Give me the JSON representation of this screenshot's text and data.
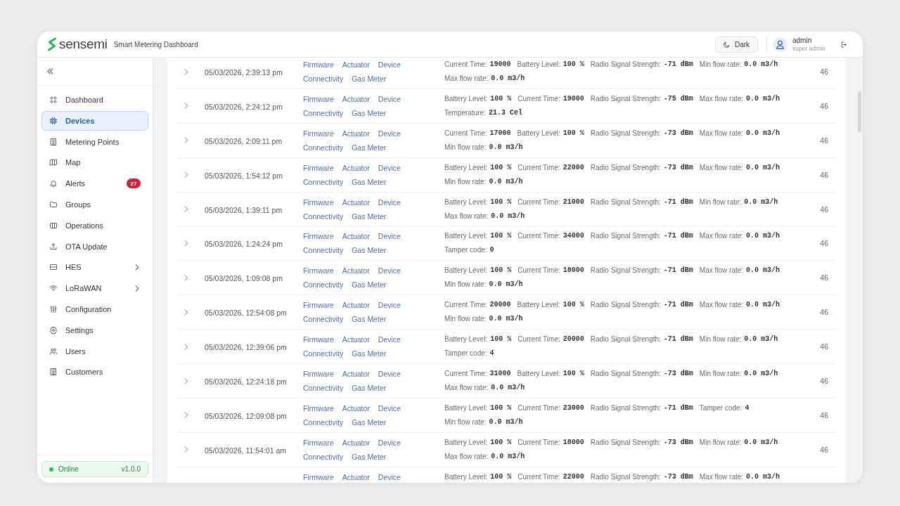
{
  "header": {
    "brand": "sensemi",
    "subtitle": "Smart Metering Dashboard",
    "theme_button": "Dark",
    "user": {
      "name": "admin",
      "role": "super admin"
    }
  },
  "sidebar": {
    "items": [
      {
        "label": "Dashboard",
        "kind": "link",
        "selected": false
      },
      {
        "label": "Devices",
        "kind": "link",
        "selected": true
      },
      {
        "label": "Metering Points",
        "kind": "link",
        "selected": false
      },
      {
        "label": "Map",
        "kind": "link",
        "selected": false
      },
      {
        "label": "Alerts",
        "kind": "link",
        "selected": false,
        "badge": "27"
      },
      {
        "label": "Groups",
        "kind": "link",
        "selected": false
      },
      {
        "label": "Operations",
        "kind": "link",
        "selected": false
      },
      {
        "label": "OTA Update",
        "kind": "link",
        "selected": false
      },
      {
        "label": "HES",
        "kind": "submenu",
        "selected": false,
        "expanded": false
      },
      {
        "label": "LoRaWAN",
        "kind": "submenu",
        "selected": false,
        "expanded": false
      },
      {
        "label": "Configuration",
        "kind": "link",
        "selected": false
      },
      {
        "label": "Settings",
        "kind": "link",
        "selected": false
      },
      {
        "label": "Users",
        "kind": "link",
        "selected": false
      },
      {
        "label": "Customers",
        "kind": "link",
        "selected": false
      }
    ],
    "footer": {
      "status": "Online",
      "version": "v1.0.0"
    }
  },
  "table": {
    "rows": [
      {
        "expanded": false,
        "timestamp": "05/03/2026, 2:39:13 pm",
        "tags": [
          "Firmware",
          "Actuator",
          "Device",
          "Connectivity",
          "Gas Meter"
        ],
        "readings": [
          {
            "label": "Current Time:",
            "value": "19000"
          },
          {
            "label": "Battery Level:",
            "value": "100 %"
          },
          {
            "label": "Radio Signal Strength:",
            "value": "-71 dBm"
          },
          {
            "label": "Min flow rate:",
            "value": "0.0 m3/h"
          },
          {
            "label": "Max flow rate:",
            "value": "0.0 m3/h"
          }
        ],
        "column_5": "46"
      },
      {
        "expanded": false,
        "timestamp": "05/03/2026, 2:24:12 pm",
        "tags": [
          "Firmware",
          "Actuator",
          "Device",
          "Connectivity",
          "Gas Meter"
        ],
        "readings": [
          {
            "label": "Battery Level:",
            "value": "100 %"
          },
          {
            "label": "Current Time:",
            "value": "19000"
          },
          {
            "label": "Radio Signal Strength:",
            "value": "-75 dBm"
          },
          {
            "label": "Max flow rate:",
            "value": "0.0 m3/h"
          },
          {
            "label": "Temperature:",
            "value": "21.3 Cel"
          }
        ],
        "column_5": "46"
      },
      {
        "expanded": false,
        "timestamp": "05/03/2026, 2:09:11 pm",
        "tags": [
          "Firmware",
          "Actuator",
          "Device",
          "Connectivity",
          "Gas Meter"
        ],
        "readings": [
          {
            "label": "Current Time:",
            "value": "17000"
          },
          {
            "label": "Battery Level:",
            "value": "100 %"
          },
          {
            "label": "Radio Signal Strength:",
            "value": "-73 dBm"
          },
          {
            "label": "Max flow rate:",
            "value": "0.0 m3/h"
          },
          {
            "label": "Min flow rate:",
            "value": "0.0 m3/h"
          }
        ],
        "column_5": "46"
      },
      {
        "expanded": false,
        "timestamp": "05/03/2026, 1:54:12 pm",
        "tags": [
          "Firmware",
          "Actuator",
          "Device",
          "Connectivity",
          "Gas Meter"
        ],
        "readings": [
          {
            "label": "Battery Level:",
            "value": "100 %"
          },
          {
            "label": "Current Time:",
            "value": "22000"
          },
          {
            "label": "Radio Signal Strength:",
            "value": "-73 dBm"
          },
          {
            "label": "Max flow rate:",
            "value": "0.0 m3/h"
          },
          {
            "label": "Min flow rate:",
            "value": "0.0 m3/h"
          }
        ],
        "column_5": "46"
      },
      {
        "expanded": false,
        "timestamp": "05/03/2026, 1:39:11 pm",
        "tags": [
          "Firmware",
          "Actuator",
          "Device",
          "Connectivity",
          "Gas Meter"
        ],
        "readings": [
          {
            "label": "Battery Level:",
            "value": "100 %"
          },
          {
            "label": "Current Time:",
            "value": "21000"
          },
          {
            "label": "Radio Signal Strength:",
            "value": "-71 dBm"
          },
          {
            "label": "Min flow rate:",
            "value": "0.0 m3/h"
          },
          {
            "label": "Max flow rate:",
            "value": "0.0 m3/h"
          }
        ],
        "column_5": "46"
      },
      {
        "expanded": false,
        "timestamp": "05/03/2026, 1:24:24 pm",
        "tags": [
          "Firmware",
          "Actuator",
          "Device",
          "Connectivity",
          "Gas Meter"
        ],
        "readings": [
          {
            "label": "Battery Level:",
            "value": "100 %"
          },
          {
            "label": "Current Time:",
            "value": "34000"
          },
          {
            "label": "Radio Signal Strength:",
            "value": "-71 dBm"
          },
          {
            "label": "Max flow rate:",
            "value": "0.0 m3/h"
          },
          {
            "label": "Tamper code:",
            "value": "0"
          }
        ],
        "column_5": "46"
      },
      {
        "expanded": false,
        "timestamp": "05/03/2026, 1:09:08 pm",
        "tags": [
          "Firmware",
          "Actuator",
          "Device",
          "Connectivity",
          "Gas Meter"
        ],
        "readings": [
          {
            "label": "Battery Level:",
            "value": "100 %"
          },
          {
            "label": "Current Time:",
            "value": "18000"
          },
          {
            "label": "Radio Signal Strength:",
            "value": "-71 dBm"
          },
          {
            "label": "Max flow rate:",
            "value": "0.0 m3/h"
          },
          {
            "label": "Min flow rate:",
            "value": "0.0 m3/h"
          }
        ],
        "column_5": "46"
      },
      {
        "expanded": false,
        "timestamp": "05/03/2026, 12:54:08 pm",
        "tags": [
          "Firmware",
          "Actuator",
          "Device",
          "Connectivity",
          "Gas Meter"
        ],
        "readings": [
          {
            "label": "Current Time:",
            "value": "20000"
          },
          {
            "label": "Battery Level:",
            "value": "100 %"
          },
          {
            "label": "Radio Signal Strength:",
            "value": "-71 dBm"
          },
          {
            "label": "Max flow rate:",
            "value": "0.0 m3/h"
          },
          {
            "label": "Min flow rate:",
            "value": "0.0 m3/h"
          }
        ],
        "column_5": "46"
      },
      {
        "expanded": false,
        "timestamp": "05/03/2026, 12:39:06 pm",
        "tags": [
          "Firmware",
          "Actuator",
          "Device",
          "Connectivity",
          "Gas Meter"
        ],
        "readings": [
          {
            "label": "Battery Level:",
            "value": "100 %"
          },
          {
            "label": "Current Time:",
            "value": "20000"
          },
          {
            "label": "Radio Signal Strength:",
            "value": "-71 dBm"
          },
          {
            "label": "Min flow rate:",
            "value": "0.0 m3/h"
          },
          {
            "label": "Tamper code:",
            "value": "4"
          }
        ],
        "column_5": "46"
      },
      {
        "expanded": false,
        "timestamp": "05/03/2026, 12:24:18 pm",
        "tags": [
          "Firmware",
          "Actuator",
          "Device",
          "Connectivity",
          "Gas Meter"
        ],
        "readings": [
          {
            "label": "Current Time:",
            "value": "31000"
          },
          {
            "label": "Battery Level:",
            "value": "100 %"
          },
          {
            "label": "Radio Signal Strength:",
            "value": "-73 dBm"
          },
          {
            "label": "Min flow rate:",
            "value": "0.0 m3/h"
          },
          {
            "label": "Max flow rate:",
            "value": "0.0 m3/h"
          }
        ],
        "column_5": "46"
      },
      {
        "expanded": false,
        "timestamp": "05/03/2026, 12:09:08 pm",
        "tags": [
          "Firmware",
          "Actuator",
          "Device",
          "Connectivity",
          "Gas Meter"
        ],
        "readings": [
          {
            "label": "Battery Level:",
            "value": "100 %"
          },
          {
            "label": "Current Time:",
            "value": "23000"
          },
          {
            "label": "Radio Signal Strength:",
            "value": "-71 dBm"
          },
          {
            "label": "Tamper code:",
            "value": "4"
          },
          {
            "label": "Min flow rate:",
            "value": "0.0 m3/h"
          }
        ],
        "column_5": "46"
      },
      {
        "expanded": false,
        "timestamp": "05/03/2026, 11:54:01 am",
        "tags": [
          "Firmware",
          "Actuator",
          "Device",
          "Connectivity",
          "Gas Meter"
        ],
        "readings": [
          {
            "label": "Battery Level:",
            "value": "100 %"
          },
          {
            "label": "Current Time:",
            "value": "18000"
          },
          {
            "label": "Radio Signal Strength:",
            "value": "-73 dBm"
          },
          {
            "label": "Min flow rate:",
            "value": "0.0 m3/h"
          },
          {
            "label": "Max flow rate:",
            "value": "0.0 m3/h"
          }
        ],
        "column_5": "46"
      },
      {
        "tags": [
          "Firmware",
          "Actuator",
          "Device"
        ],
        "readings": [
          {
            "label": "Battery Level:",
            "value": "100 %"
          },
          {
            "label": "Current Time:",
            "value": "22000"
          },
          {
            "label": "Radio Signal Strength:",
            "value": "-73 dBm"
          },
          {
            "label": "Max flow rate:",
            "value": "0.0 m3/h"
          }
        ]
      }
    ]
  }
}
